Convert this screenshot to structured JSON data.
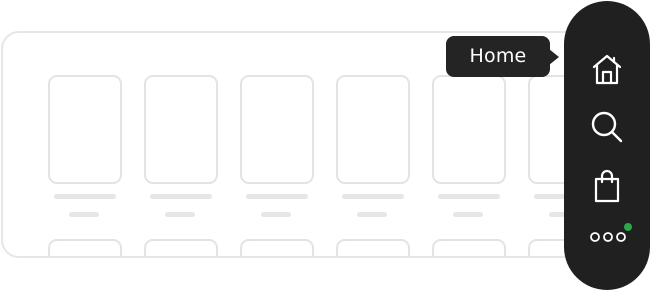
{
  "tooltip": {
    "label": "Home"
  },
  "dock": {
    "items": [
      {
        "name": "home",
        "icon": "home-icon"
      },
      {
        "name": "search",
        "icon": "search-icon"
      },
      {
        "name": "bag",
        "icon": "shopping-bag-icon"
      },
      {
        "name": "more",
        "icon": "more-icon"
      }
    ],
    "status_indicator_color": "#2aa84a"
  },
  "colors": {
    "dock_background": "#202020",
    "tooltip_background": "#242424",
    "icon_color": "#ffffff",
    "skeleton_border": "#e3e3e3"
  }
}
